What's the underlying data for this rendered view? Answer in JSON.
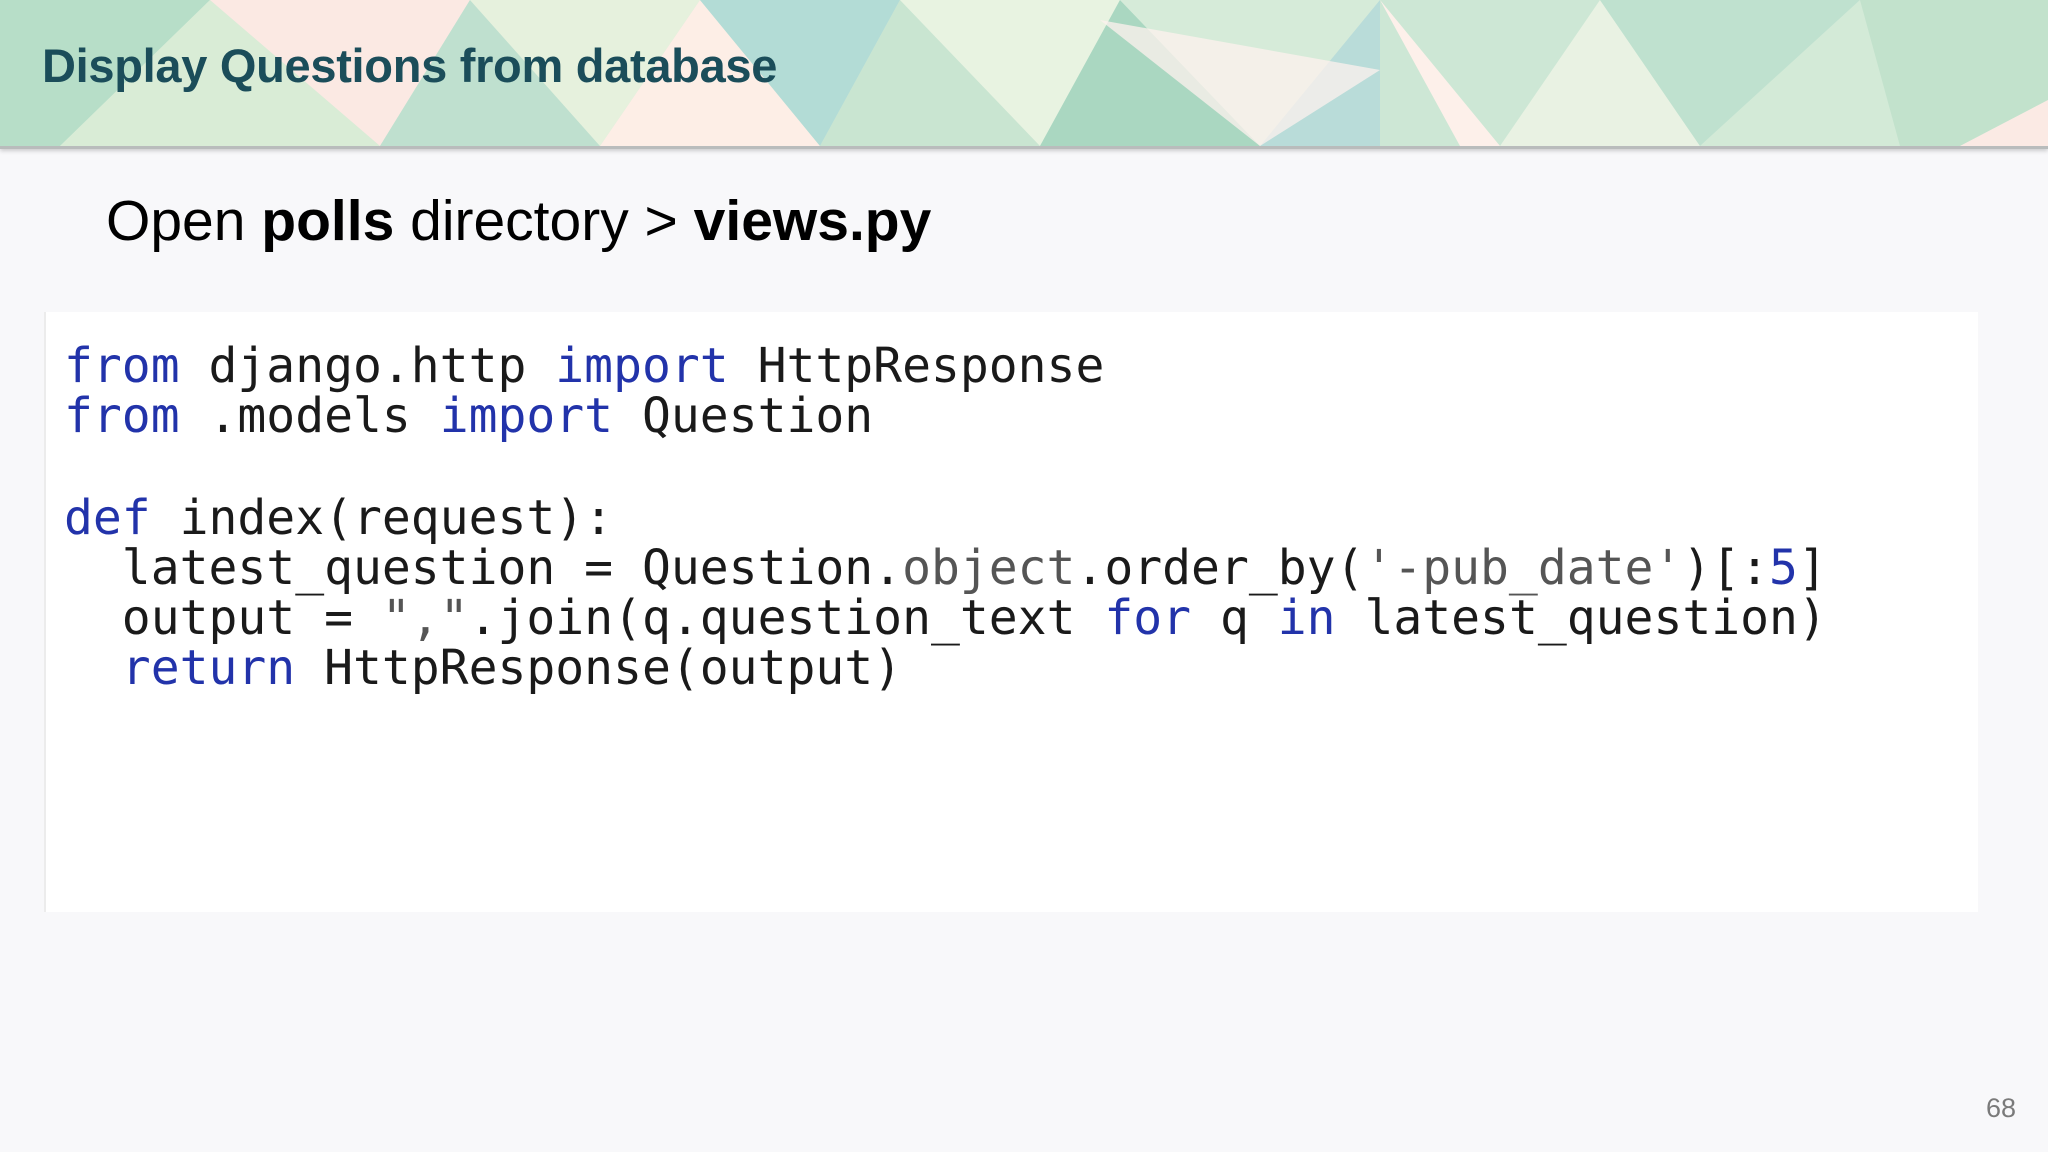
{
  "slide": {
    "title": "Display Questions from database",
    "instruction": {
      "prefix": "Open ",
      "folder": "polls",
      "middle": " directory > ",
      "file": "views.py"
    },
    "page_number": "68"
  },
  "code": {
    "lines": [
      {
        "tokens": [
          {
            "t": "from",
            "k": "kw"
          },
          {
            "t": " django.http ",
            "k": ""
          },
          {
            "t": "import",
            "k": "kw"
          },
          {
            "t": " HttpResponse",
            "k": ""
          }
        ]
      },
      {
        "tokens": [
          {
            "t": "from",
            "k": "kw"
          },
          {
            "t": " .models ",
            "k": ""
          },
          {
            "t": "import",
            "k": "kw"
          },
          {
            "t": " Question",
            "k": ""
          }
        ]
      },
      {
        "tokens": []
      },
      {
        "tokens": [
          {
            "t": "def",
            "k": "kw"
          },
          {
            "t": " index(request):",
            "k": ""
          }
        ]
      },
      {
        "tokens": [
          {
            "t": "  latest_question = Question.",
            "k": ""
          },
          {
            "t": "object",
            "k": "dim"
          },
          {
            "t": ".order_by(",
            "k": ""
          },
          {
            "t": "'-pub_date'",
            "k": "str"
          },
          {
            "t": ")[:",
            "k": ""
          },
          {
            "t": "5",
            "k": "kw"
          },
          {
            "t": "]",
            "k": ""
          }
        ]
      },
      {
        "tokens": [
          {
            "t": "  output = ",
            "k": ""
          },
          {
            "t": "\",\"",
            "k": "str"
          },
          {
            "t": ".join(q.question_text ",
            "k": ""
          },
          {
            "t": "for",
            "k": "kw"
          },
          {
            "t": " q ",
            "k": ""
          },
          {
            "t": "in",
            "k": "kw"
          },
          {
            "t": " latest_question)",
            "k": ""
          }
        ]
      },
      {
        "tokens": [
          {
            "t": "  ",
            "k": ""
          },
          {
            "t": "return",
            "k": "kw"
          },
          {
            "t": " HttpResponse(output)",
            "k": ""
          }
        ]
      }
    ]
  }
}
